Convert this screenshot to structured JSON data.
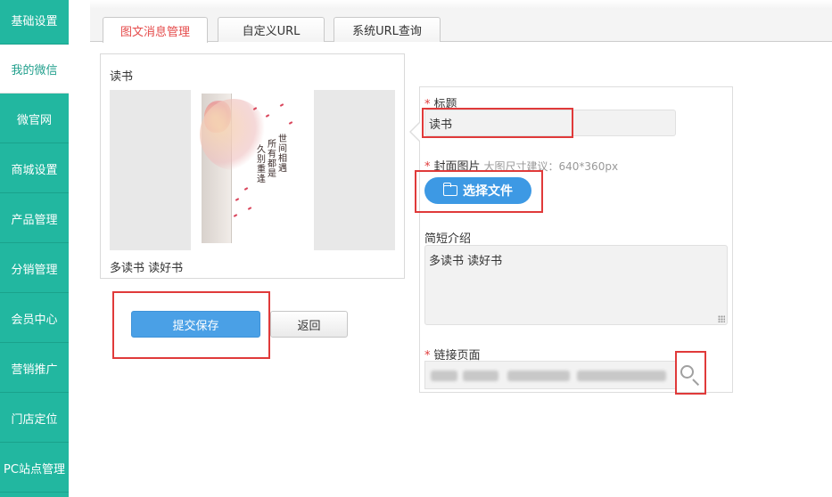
{
  "sidebar": {
    "items": [
      {
        "label": "基础设置",
        "active": false
      },
      {
        "label": "我的微信",
        "active": true
      },
      {
        "label": "微官网",
        "active": false
      },
      {
        "label": "商城设置",
        "active": false
      },
      {
        "label": "产品管理",
        "active": false
      },
      {
        "label": "分销管理",
        "active": false
      },
      {
        "label": "会员中心",
        "active": false
      },
      {
        "label": "营销推广",
        "active": false
      },
      {
        "label": "门店定位",
        "active": false
      },
      {
        "label": "PC站点管理",
        "active": false
      }
    ]
  },
  "tabs": [
    {
      "label": "图文消息管理",
      "active": true
    },
    {
      "label": "自定义URL",
      "active": false
    },
    {
      "label": "系统URL查询",
      "active": false
    }
  ],
  "preview": {
    "title": "读书",
    "description": "多读书 读好书",
    "cover_text": [
      "世",
      "间",
      "所",
      "有",
      "相",
      "遇",
      "都",
      "是",
      "久",
      "别",
      "重",
      "逢"
    ]
  },
  "actions": {
    "submit_label": "提交保存",
    "back_label": "返回"
  },
  "form": {
    "title_label": "标题",
    "title_value": "读书",
    "cover_label": "封面图片",
    "cover_hint": "大图尺寸建议：640*360px",
    "choose_file_label": "选择文件",
    "summary_label": "简短介绍",
    "summary_value": "多读书  读好书",
    "link_label": "链接页面",
    "required_mark": "*"
  },
  "colors": {
    "sidebar_bg": "#22b7a0",
    "active_tab_text": "#e54b4b",
    "primary_button": "#4aa0e6",
    "highlight_box": "#e03a3a"
  },
  "icons": {
    "folder": "folder-icon",
    "search": "search-icon"
  }
}
